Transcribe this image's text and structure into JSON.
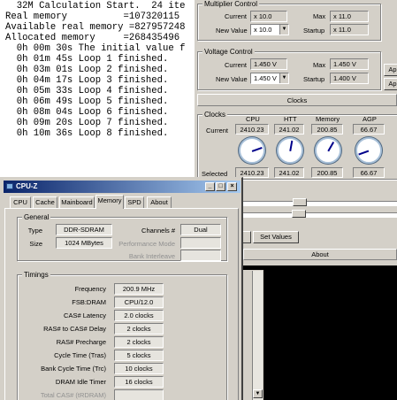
{
  "log": {
    "lines": [
      "  32M Calculation Start.  24 ite",
      "Real memory          =107320115",
      "Available real memory =827957248",
      "Allocated memory     =268435496",
      "  0h 00m 30s The initial value f",
      "  0h 01m 45s Loop 1 finished.",
      "  0h 03m 01s Loop 2 finished.",
      "  0h 04m 17s Loop 3 finished.",
      "  0h 05m 33s Loop 4 finished.",
      "  0h 06m 49s Loop 5 finished.",
      "  0h 08m 04s Loop 6 finished.",
      "  0h 09m 20s Loop 7 finished.",
      "  0h 10m 36s Loop 8 finished."
    ]
  },
  "clocktool": {
    "multiplier": {
      "title": "Multiplier Control",
      "current_label": "Current",
      "current_value": "x 10.0",
      "max_label": "Max",
      "max_value": "x 11.0",
      "newvalue_label": "New Value",
      "newvalue_value": "x 10.0",
      "startup_label": "Startup",
      "startup_value": "x 11.0"
    },
    "voltage": {
      "title": "Voltage Control",
      "current_label": "Current",
      "current_value": "1.450 V",
      "max_label": "Max",
      "max_value": "1.450 V",
      "newvalue_label": "New Value",
      "newvalue_value": "1.450 V",
      "startup_label": "Startup",
      "startup_value": "1.400 V"
    },
    "apply_buttons": [
      "Ap",
      "Ap"
    ],
    "clocks_tab": "Clocks",
    "clocks": {
      "title": "Clocks",
      "columns": [
        "CPU",
        "HTT",
        "Memory",
        "AGP"
      ],
      "current_label": "Current",
      "current": [
        "2410.23",
        "241.02",
        "200.85",
        "66.67"
      ],
      "selected_label": "Selected",
      "selected": [
        "2410.23",
        "241.02",
        "200.85",
        "66.67"
      ]
    },
    "set_values_label": "Set Values",
    "about_tab": "About"
  },
  "cpuz": {
    "title": "CPU-Z",
    "tabs": [
      "CPU",
      "Cache",
      "Mainboard",
      "Memory",
      "SPD",
      "About"
    ],
    "active_tab": "Memory",
    "general": {
      "title": "General",
      "type_label": "Type",
      "type_value": "DDR-SDRAM",
      "size_label": "Size",
      "size_value": "1024 MBytes",
      "channels_label": "Channels #",
      "channels_value": "Dual",
      "perf_label": "Performance Mode",
      "bank_label": "Bank Interleave"
    },
    "timings": {
      "title": "Timings",
      "rows": [
        {
          "label": "Frequency",
          "value": "200.9 MHz"
        },
        {
          "label": "FSB:DRAM",
          "value": "CPU/12.0"
        },
        {
          "label": "CAS# Latency",
          "value": "2.0 clocks"
        },
        {
          "label": "RAS# to CAS# Delay",
          "value": "2 clocks"
        },
        {
          "label": "RAS# Precharge",
          "value": "2 clocks"
        },
        {
          "label": "Cycle Time (Tras)",
          "value": "5 clocks"
        },
        {
          "label": "Bank Cycle Time (Trc)",
          "value": "10 clocks"
        },
        {
          "label": "DRAM Idle Timer",
          "value": "16 clocks"
        },
        {
          "label": "Total CAS# (tRDRAM)",
          "value": ""
        }
      ]
    }
  }
}
